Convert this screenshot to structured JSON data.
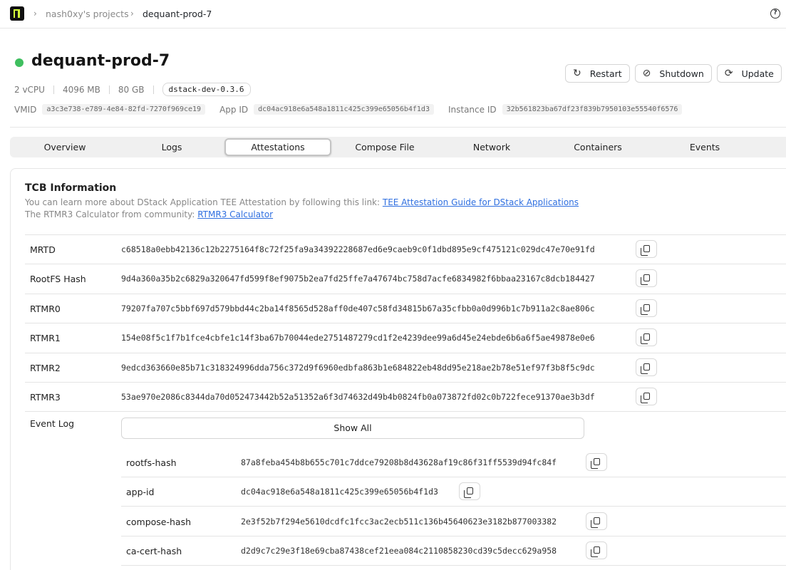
{
  "breadcrumb": {
    "project": "nash0xy's projects",
    "current": "dequant-prod-7"
  },
  "header": {
    "title": "dequant-prod-7",
    "status_color": "#3fbf5f",
    "vcpu": "2 vCPU",
    "memory": "4096 MB",
    "disk": "80 GB",
    "image": "dstack-dev-0.3.6",
    "vmid_label": "VMID",
    "vmid": "a3c3e738-e789-4e84-82fd-7270f969ce19",
    "appid_label": "App ID",
    "appid": "dc04ac918e6a548a1811c425c399e65056b4f1d3",
    "instance_label": "Instance ID",
    "instance_id": "32b561823ba67df23f839b7950103e55540f6576"
  },
  "actions": {
    "restart": "Restart",
    "shutdown": "Shutdown",
    "update": "Update"
  },
  "tabs": [
    "Overview",
    "Logs",
    "Attestations",
    "Compose File",
    "Network",
    "Containers",
    "Events"
  ],
  "active_tab": "Attestations",
  "tcb": {
    "title": "TCB Information",
    "desc1": "You can learn more about DStack Application TEE Attestation by following this link: ",
    "link1": "TEE Attestation Guide for DStack Applications",
    "desc2": "The RTMR3 Calculator from community: ",
    "link2": "RTMR3 Calculator",
    "rows": [
      {
        "key": "MRTD",
        "value": "c68518a0ebb42136c12b2275164f8c72f25fa9a34392228687ed6e9caeb9c0f1dbd895e9cf475121c029dc47e70e91fd"
      },
      {
        "key": "RootFS Hash",
        "value": "9d4a360a35b2c6829a320647fd599f8ef9075b2ea7fd25ffe7a47674bc758d7acfe6834982f6bbaa23167c8dcb184427"
      },
      {
        "key": "RTMR0",
        "value": "79207fa707c5bbf697d579bbd44c2ba14f8565d528aff0de407c58fd34815b67a35cfbb0a0d996b1c7b911a2c8ae806c"
      },
      {
        "key": "RTMR1",
        "value": "154e08f5c1f7b1fce4cbfe1c14f3ba67b70044ede2751487279cd1f2e4239dee99a6d45e24ebde6b6a6f5ae49878e0e6"
      },
      {
        "key": "RTMR2",
        "value": "9edcd363660e85b71c318324996dda756c372d9f6960edbfa863b1e684822eb48dd95e218ae2b78e51ef97f3b8f5c9dc"
      },
      {
        "key": "RTMR3",
        "value": "53ae970e2086c8344da70d052473442b52a51352a6f3d74632d49b4b0824fb0a073872fd02c0b722fece91370ae3b3df"
      }
    ],
    "event_log_label": "Event Log",
    "show_all": "Show All",
    "events": [
      {
        "key": "rootfs-hash",
        "value": "87a8feba454b8b655c701c7ddce79208b8d43628af19c86f31ff5539d94fc84f"
      },
      {
        "key": "app-id",
        "value": "dc04ac918e6a548a1811c425c399e65056b4f1d3"
      },
      {
        "key": "compose-hash",
        "value": "2e3f52b7f294e5610dcdfc1fcc3ac2ecb511c136b45640623e3182b877003382"
      },
      {
        "key": "ca-cert-hash",
        "value": "d2d9c7c29e3f18e69cba87438cef21eea084c2110858230cd39c5decc629a958"
      }
    ]
  }
}
